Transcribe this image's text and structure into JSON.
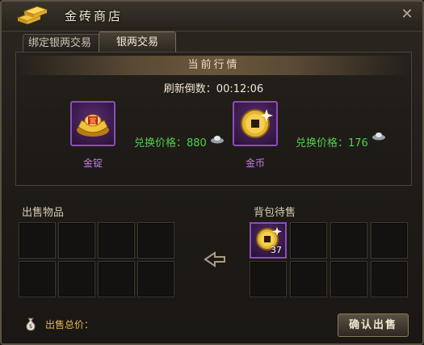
{
  "window": {
    "title": "金砖商店",
    "close_glyph": "✕"
  },
  "tabs": [
    {
      "label": "绑定银两交易",
      "active": false
    },
    {
      "label": "银两交易",
      "active": true
    }
  ],
  "market": {
    "header": "当前行情",
    "refresh_text": "刷新倒数：00:12:06",
    "items": [
      {
        "name": "金锭",
        "price_text": "兑换价格：880",
        "icon": "gold-ingot-icon"
      },
      {
        "name": "金币",
        "price_text": "兑换价格：176",
        "icon": "gold-coin-icon"
      }
    ]
  },
  "sell_section": {
    "label": "出售物品"
  },
  "bag_section": {
    "label": "背包待售",
    "items": [
      {
        "icon": "gold-coin-icon",
        "quantity": "37"
      }
    ]
  },
  "footer": {
    "total_label": "出售总价：",
    "confirm_label": "确认出售"
  },
  "colors": {
    "accent_green": "#4fd14a",
    "item_purple": "#c87ce8",
    "gold": "#e3b94a"
  }
}
